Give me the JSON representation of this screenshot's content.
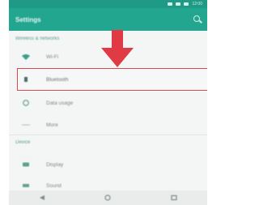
{
  "status_bar": {
    "time": "12:00",
    "icons": [
      "wifi-icon",
      "signal-icon",
      "battery-icon"
    ]
  },
  "app_bar": {
    "title": "Settings",
    "search_icon": "search-icon"
  },
  "sections": [
    {
      "header": "Wireless & networks",
      "items": [
        {
          "label": "Wi-Fi",
          "icon": "wifi-icon"
        },
        {
          "label": "Bluetooth",
          "icon": "bluetooth-icon",
          "highlighted": true
        },
        {
          "label": "Data usage",
          "icon": "data-usage-icon"
        },
        {
          "label": "More",
          "icon": "more-icon"
        }
      ]
    },
    {
      "header": "Device",
      "items": [
        {
          "label": "Display",
          "icon": "display-icon"
        },
        {
          "label": "Sound",
          "icon": "sound-icon"
        }
      ]
    }
  ],
  "nav_bar": [
    "back-icon",
    "home-icon",
    "recents-icon"
  ],
  "colors": {
    "app_bar": "#23a690",
    "status_bar": "#1f9a86",
    "highlight_border": "#d94a55",
    "arrow": "#e03a45"
  }
}
